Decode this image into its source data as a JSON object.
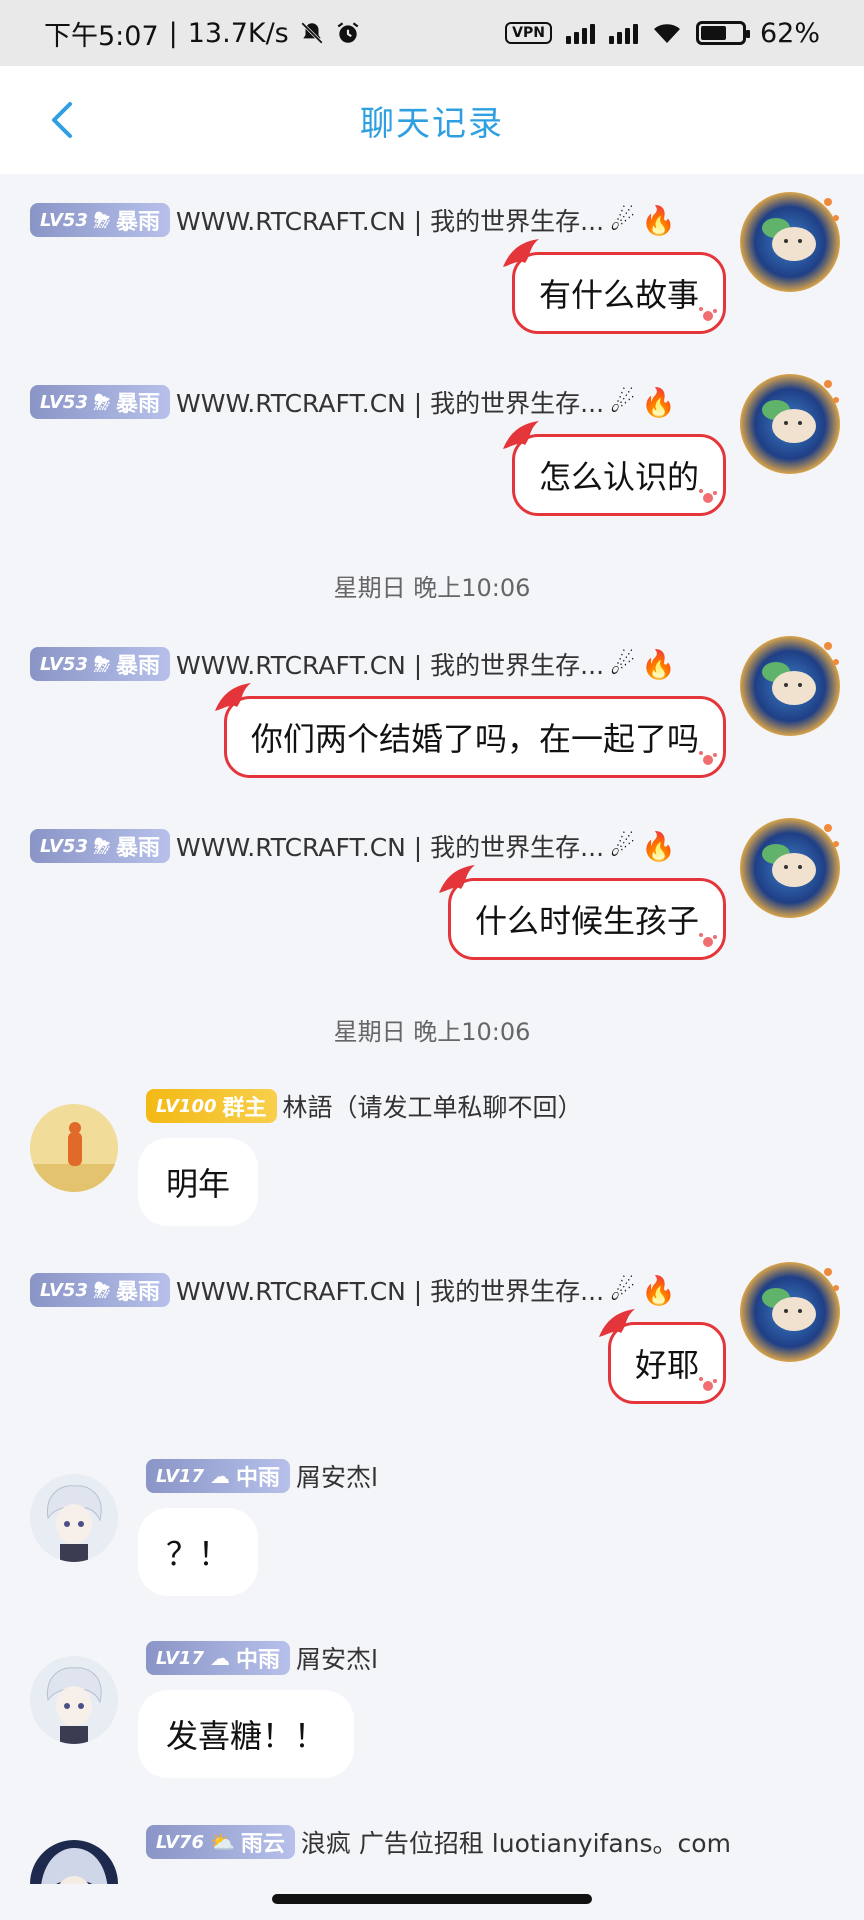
{
  "status_bar": {
    "time": "下午5:07",
    "separator": "|",
    "speed": "13.7K/s",
    "vpn": "VPN",
    "battery": "62%"
  },
  "header": {
    "title": "聊天记录"
  },
  "colors": {
    "accent": "#2e9fe0",
    "bubble_border": "#e4363a",
    "background": "#f4f5f9"
  },
  "messages": [
    {
      "type": "out",
      "level": "LV53",
      "weather": "暴雨",
      "sender": "WWW.RTCRAFT.CN | 我的世界生存...",
      "text": "有什么故事"
    },
    {
      "type": "out",
      "level": "LV53",
      "weather": "暴雨",
      "sender": "WWW.RTCRAFT.CN | 我的世界生存...",
      "text": "怎么认识的"
    },
    {
      "type": "time",
      "text": "星期日 晚上10:06"
    },
    {
      "type": "out",
      "level": "LV53",
      "weather": "暴雨",
      "sender": "WWW.RTCRAFT.CN | 我的世界生存...",
      "text": "你们两个结婚了吗，在一起了吗"
    },
    {
      "type": "out",
      "level": "LV53",
      "weather": "暴雨",
      "sender": "WWW.RTCRAFT.CN | 我的世界生存...",
      "text": "什么时候生孩子"
    },
    {
      "type": "time",
      "text": "星期日 晚上10:06"
    },
    {
      "type": "in",
      "level": "LV100",
      "weather": "群主",
      "sender": "林語（请发工单私聊不回）",
      "text": "明年"
    },
    {
      "type": "out",
      "level": "LV53",
      "weather": "暴雨",
      "sender": "WWW.RTCRAFT.CN | 我的世界生存...",
      "text": "好耶"
    },
    {
      "type": "in",
      "level": "LV17",
      "weather": "中雨",
      "sender": "屑安杰l",
      "text": "？！"
    },
    {
      "type": "in",
      "level": "LV17",
      "weather": "中雨",
      "sender": "屑安杰l",
      "text": "发喜糖！！"
    },
    {
      "type": "in",
      "level": "LV76",
      "weather": "雨云",
      "sender": "浪疯 广告位招租 luotianyifans。com",
      "text": ""
    }
  ]
}
